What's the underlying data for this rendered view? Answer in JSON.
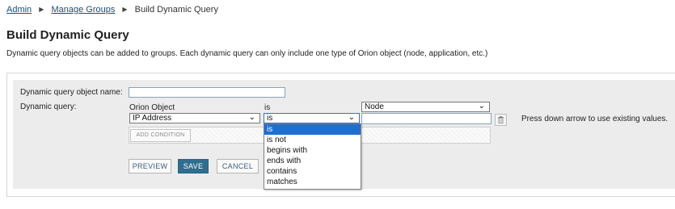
{
  "breadcrumb": {
    "items": [
      {
        "label": "Admin"
      },
      {
        "label": "Manage Groups"
      },
      {
        "label": "Build Dynamic Query"
      }
    ]
  },
  "page": {
    "title": "Build Dynamic Query",
    "description": "Dynamic query objects can be added to groups. Each dynamic query can only include one type of Orion object (node, application, etc.)"
  },
  "form": {
    "name_label": "Dynamic query object name:",
    "name_value": "",
    "query_label": "Dynamic query:",
    "orion_object_label": "Orion Object",
    "is_label": "is",
    "object_type_value": "Node",
    "property_value": "IP Address",
    "operator_value": "is",
    "value_field": "",
    "add_condition_label": "ADD CONDITION",
    "hint": "Press down arrow to use existing values."
  },
  "operator_dropdown": {
    "options": [
      "is",
      "is not",
      "begins with",
      "ends with",
      "contains",
      "matches"
    ],
    "selected": "is"
  },
  "actions": {
    "preview_label": "PREVIEW",
    "save_label": "SAVE",
    "cancel_label": "CANCEL"
  },
  "icons": {
    "delete_condition": "trash-icon",
    "select_arrow": "chevron-down-icon",
    "breadcrumb_separator": "triangle-right-icon"
  },
  "colors": {
    "primary_button": "#2f6e8e",
    "link": "#1a4f7a",
    "dropdown_highlight": "#1f6fd1",
    "panel_background": "#ececec"
  }
}
